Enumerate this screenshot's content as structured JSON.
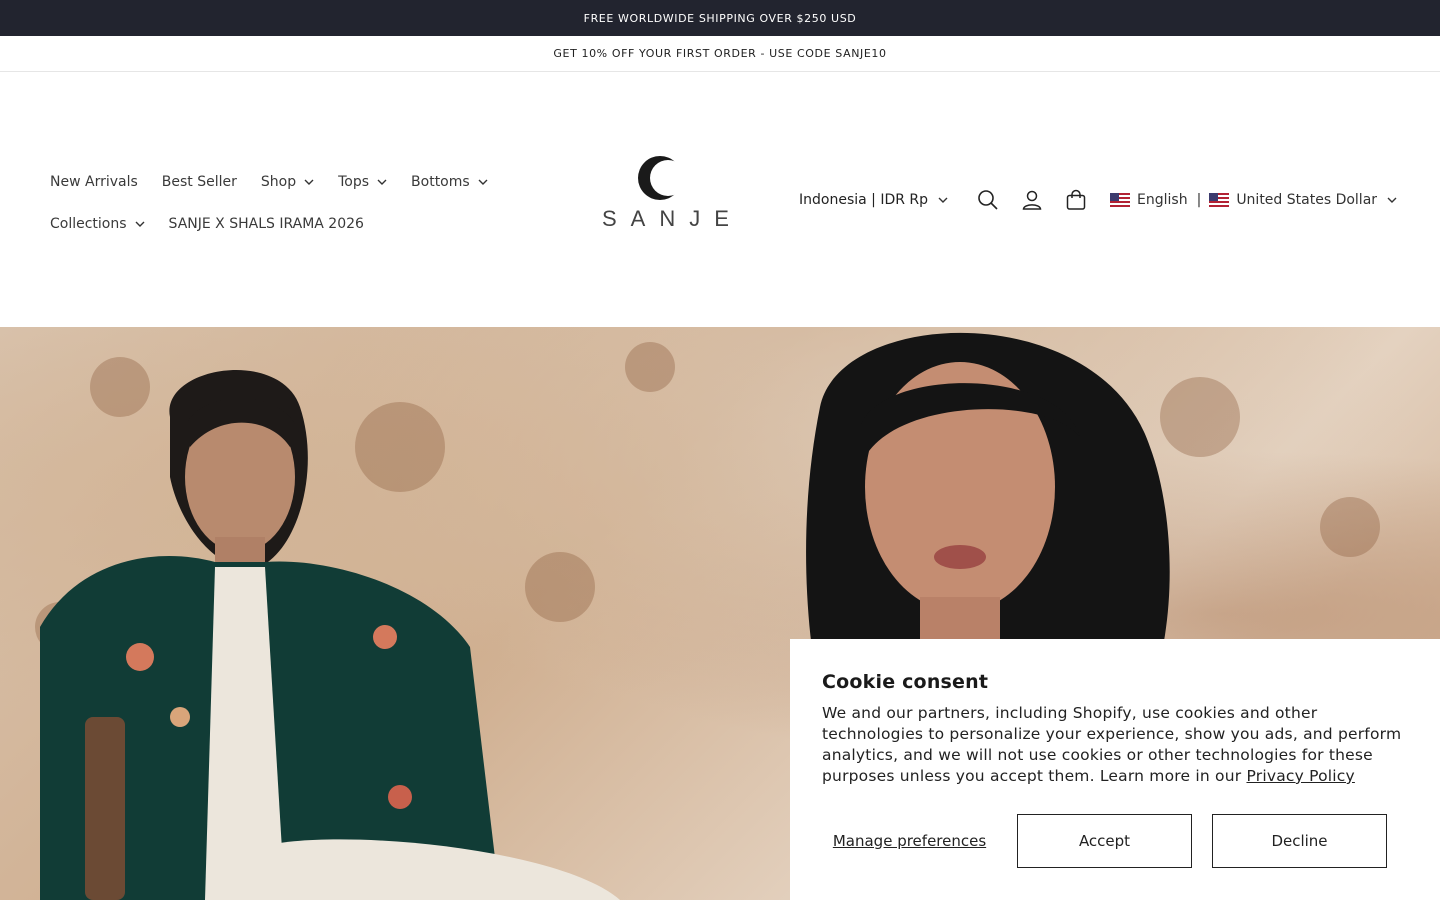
{
  "announcements": {
    "top": "FREE WORLDWIDE SHIPPING OVER $250 USD",
    "second": "GET 10% OFF YOUR FIRST ORDER - USE CODE SANJE10"
  },
  "nav": {
    "row1": [
      {
        "label": "New Arrivals",
        "dropdown": false
      },
      {
        "label": "Best Seller",
        "dropdown": false
      },
      {
        "label": "Shop",
        "dropdown": true
      },
      {
        "label": "Tops",
        "dropdown": true
      },
      {
        "label": "Bottoms",
        "dropdown": true
      }
    ],
    "row2": [
      {
        "label": "Collections",
        "dropdown": true
      },
      {
        "label": "SANJE X SHALS IRAMA 2026",
        "dropdown": false
      }
    ]
  },
  "logo": {
    "text": "SANJE"
  },
  "header_tools": {
    "country": "Indonesia | IDR Rp",
    "icons": [
      "search-icon",
      "account-icon",
      "cart-icon"
    ],
    "language": "English",
    "separator": "|",
    "currency": "United States Dollar"
  },
  "cookie": {
    "title": "Cookie consent",
    "body": "We and our partners, including Shopify, use cookies and other technologies to personalize your experience, show you ads, and perform analytics, and we will not use cookies or other technologies for these purposes unless you accept them. Learn more in our",
    "link": "Privacy Policy",
    "manage": "Manage preferences",
    "accept": "Accept",
    "decline": "Decline"
  },
  "colors": {
    "announce_bg": "#22242f",
    "text": "#222222",
    "hero_tone": "#d9c3ad"
  }
}
